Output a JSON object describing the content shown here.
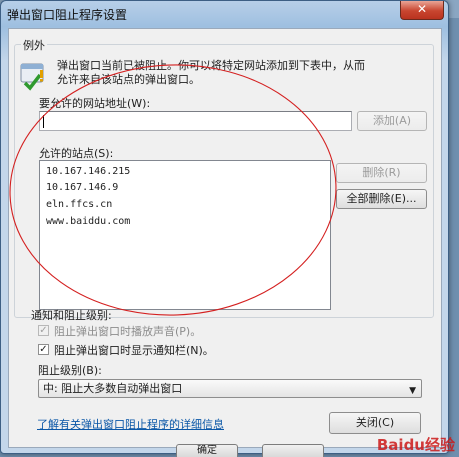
{
  "window": {
    "title": "弹出窗口阻止程序设置",
    "close_label": "✕"
  },
  "exceptions": {
    "group_label": "例外",
    "info_line1": "弹出窗口当前已被阻止。你可以将特定网站添加到下表中，从而",
    "info_line2": "允许来自该站点的弹出窗口。",
    "address_label": "要允许的网站地址(W):",
    "address_value": "",
    "add_button": "添加(A)",
    "allowed_label": "允许的站点(S):",
    "allowed_sites": [
      "10.167.146.215",
      "10.167.146.9",
      "eln.ffcs.cn",
      "www.baiddu.com"
    ],
    "remove_button": "删除(R)",
    "remove_all_button": "全部删除(E)..."
  },
  "notifications": {
    "group_label": "通知和阻止级别:",
    "play_sound_label": "阻止弹出窗口时播放声音(P)。",
    "play_sound_checked": true,
    "show_bar_label": "阻止弹出窗口时显示通知栏(N)。",
    "show_bar_checked": true,
    "level_label": "阻止级别(B):",
    "level_value": "中: 阻止大多数自动弹出窗口"
  },
  "footer": {
    "learn_more_link": "了解有关弹出窗口阻止程序的详细信息",
    "close_button": "关闭(C)",
    "watermark": "Baidu经验"
  },
  "underlying": {
    "ok_button": "确定"
  },
  "colors": {
    "annotation_ellipse": "#d42020",
    "link": "#0b57a7"
  }
}
